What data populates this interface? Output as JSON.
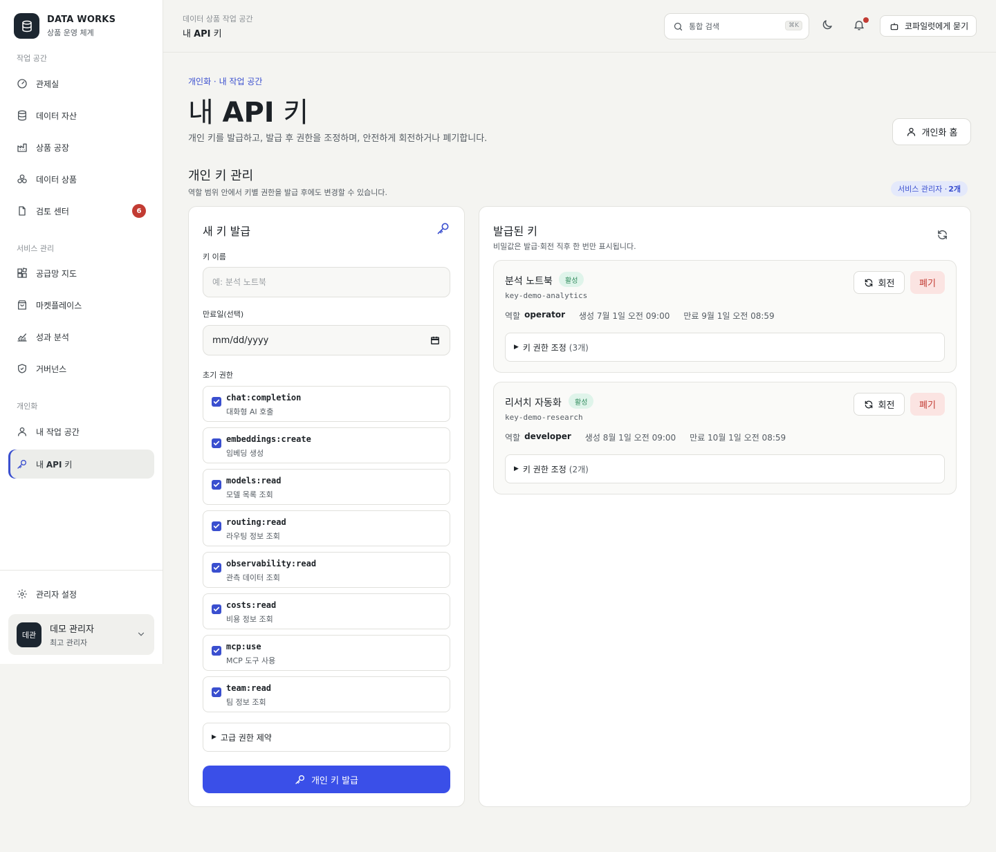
{
  "brand": {
    "name": "DATA WORKS",
    "subtitle": "상품 운영 체계"
  },
  "sidebar": {
    "sections": [
      {
        "label": "작업 공간"
      },
      {
        "label": "서비스 관리"
      },
      {
        "label": "개인화"
      }
    ],
    "items": [
      {
        "label": "관제실",
        "icon": "gauge-icon"
      },
      {
        "label": "데이터 자산",
        "icon": "database-icon"
      },
      {
        "label": "상품 공장",
        "icon": "factory-icon"
      },
      {
        "label": "데이터 상품",
        "icon": "boxes-icon"
      },
      {
        "label": "검토 센터",
        "icon": "file-icon",
        "badge": "6"
      },
      {
        "label": "공급망 지도",
        "icon": "blocks-icon"
      },
      {
        "label": "마켓플레이스",
        "icon": "shopping-bag-icon"
      },
      {
        "label": "성과 분석",
        "icon": "chart-line-icon"
      },
      {
        "label": "거버넌스",
        "icon": "shield-check-icon"
      },
      {
        "label": "내 작업 공간",
        "icon": "user-icon"
      },
      {
        "label_pre": "내 ",
        "label_strong": "API",
        "label_post": " 키",
        "icon": "key-icon",
        "active": true
      }
    ],
    "settings_label": "관리자 설정",
    "user": {
      "avatar": "데관",
      "name": "데모 관리자",
      "role": "최고 관리자"
    }
  },
  "header": {
    "crumb_parent": "데이터 상품 작업 공간",
    "crumb_pre": "내 ",
    "crumb_strong": "API",
    "crumb_post": " 키",
    "search_placeholder": "통합 검색",
    "search_shortcut": "⌘K",
    "copilot_label": "코파일럿에게 묻기"
  },
  "page": {
    "eyebrow": "개인화 · 내 작업 공간",
    "title_pre": "내 ",
    "title_strong": "API",
    "title_post": " 키",
    "description": "개인 키를 발급하고, 발급 후 권한을 조정하며, 안전하게 회전하거나 폐기합니다.",
    "home_button": "개인화 홈",
    "section_title": "개인 키 관리",
    "section_desc": "역할 범위 안에서 키별 권한을 발급 후에도 변경할 수 있습니다.",
    "role_pill_pre": "서비스 관리자 · ",
    "role_pill_count": "2개"
  },
  "new_key": {
    "title": "새 키 발급",
    "name_label": "키 이름",
    "name_placeholder": "예: 분석 노트북",
    "expiry_label": "만료일(선택)",
    "expiry_placeholder": "mm/dd/yyyy",
    "perms_label": "초기 권한",
    "permissions": [
      {
        "code": "chat:completion",
        "desc": "대화형 AI 호출",
        "checked": true
      },
      {
        "code": "embeddings:create",
        "desc": "임베딩 생성",
        "checked": true
      },
      {
        "code": "models:read",
        "desc": "모델 목록 조회",
        "checked": true
      },
      {
        "code": "routing:read",
        "desc": "라우팅 정보 조회",
        "checked": true
      },
      {
        "code": "observability:read",
        "desc": "관측 데이터 조회",
        "checked": true
      },
      {
        "code": "costs:read",
        "desc": "비용 정보 조회",
        "checked": true
      },
      {
        "code": "mcp:use",
        "desc": "MCP 도구 사용",
        "checked": true
      },
      {
        "code": "team:read",
        "desc": "팀 정보 조회",
        "checked": true
      }
    ],
    "advanced_label": "고급 권한 제약",
    "submit_label": "개인 키 발급"
  },
  "issued": {
    "title": "발급된 키",
    "subtitle": "비밀값은 발급·회전 직후 한 번만 표시됩니다.",
    "keys": [
      {
        "name": "분석 노트북",
        "status": "활성",
        "id": "key-demo-analytics",
        "role_label": "역할",
        "role": "operator",
        "created": "생성 7월 1일 오전 09:00",
        "expires": "만료 9월 1일 오전 08:59",
        "perm_toggle": "키 권한 조정",
        "perm_count": "(3개)",
        "rotate": "회전",
        "revoke": "폐기"
      },
      {
        "name": "리서치 자동화",
        "status": "활성",
        "id": "key-demo-research",
        "role_label": "역할",
        "role": "developer",
        "created": "생성 8월 1일 오전 09:00",
        "expires": "만료 10월 1일 오전 08:59",
        "perm_toggle": "키 권한 조정",
        "perm_count": "(2개)",
        "rotate": "회전",
        "revoke": "폐기"
      }
    ]
  },
  "colors": {
    "accent": "#3a4fe8",
    "danger": "#c23b33",
    "success": "#2f8a5b",
    "dark": "#1c2630"
  }
}
